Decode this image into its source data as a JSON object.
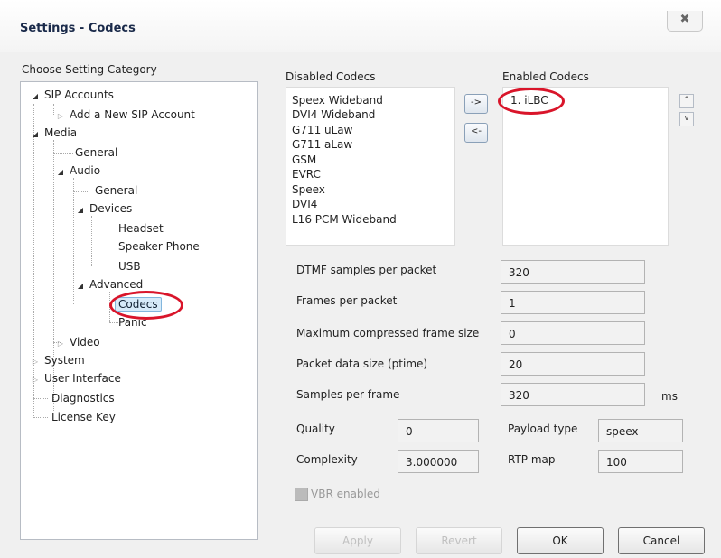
{
  "window": {
    "title": "Settings - Codecs",
    "close_icon": "close-icon"
  },
  "category": {
    "label": "Choose Setting Category",
    "tree": {
      "sip_accounts": "SIP Accounts",
      "add_sip_account": "Add a New SIP Account",
      "media": "Media",
      "media_general": "General",
      "audio": "Audio",
      "audio_general": "General",
      "devices": "Devices",
      "headset": "Headset",
      "speaker_phone": "Speaker Phone",
      "usb": "USB",
      "advanced": "Advanced",
      "codecs": "Codecs",
      "panic": "Panic",
      "video": "Video",
      "system": "System",
      "user_interface": "User Interface",
      "diagnostics": "Diagnostics",
      "license_key": "License Key"
    }
  },
  "codecs": {
    "disabled_label": "Disabled Codecs",
    "disabled": [
      "Speex Wideband",
      "DVI4 Wideband",
      "G711 uLaw",
      "G711 aLaw",
      "GSM",
      "EVRC",
      "Speex",
      "DVI4",
      "L16 PCM Wideband"
    ],
    "enabled_label": "Enabled Codecs",
    "enabled": [
      "1. iLBC"
    ],
    "add_button": "->",
    "remove_button": "<-",
    "move_up": "^",
    "move_down": "v"
  },
  "params": {
    "dtmf_label": "DTMF samples per packet",
    "dtmf_value": "320",
    "frames_label": "Frames per packet",
    "frames_value": "1",
    "max_frame_label": "Maximum compressed frame size",
    "max_frame_value": "0",
    "ptime_label": "Packet data size (ptime)",
    "ptime_value": "20",
    "samples_label": "Samples per frame",
    "samples_value": "320",
    "samples_unit": "ms",
    "quality_label": "Quality",
    "quality_value": "0",
    "complexity_label": "Complexity",
    "complexity_value": "3.000000",
    "payload_label": "Payload type",
    "payload_value": "speex",
    "rtp_label": "RTP map",
    "rtp_value": "100",
    "vbr_label": "VBR enabled"
  },
  "buttons": {
    "apply": "Apply",
    "revert": "Revert",
    "ok": "OK",
    "cancel": "Cancel"
  },
  "colors": {
    "annotation": "#d9152a",
    "selection": "#d7ebf9"
  }
}
